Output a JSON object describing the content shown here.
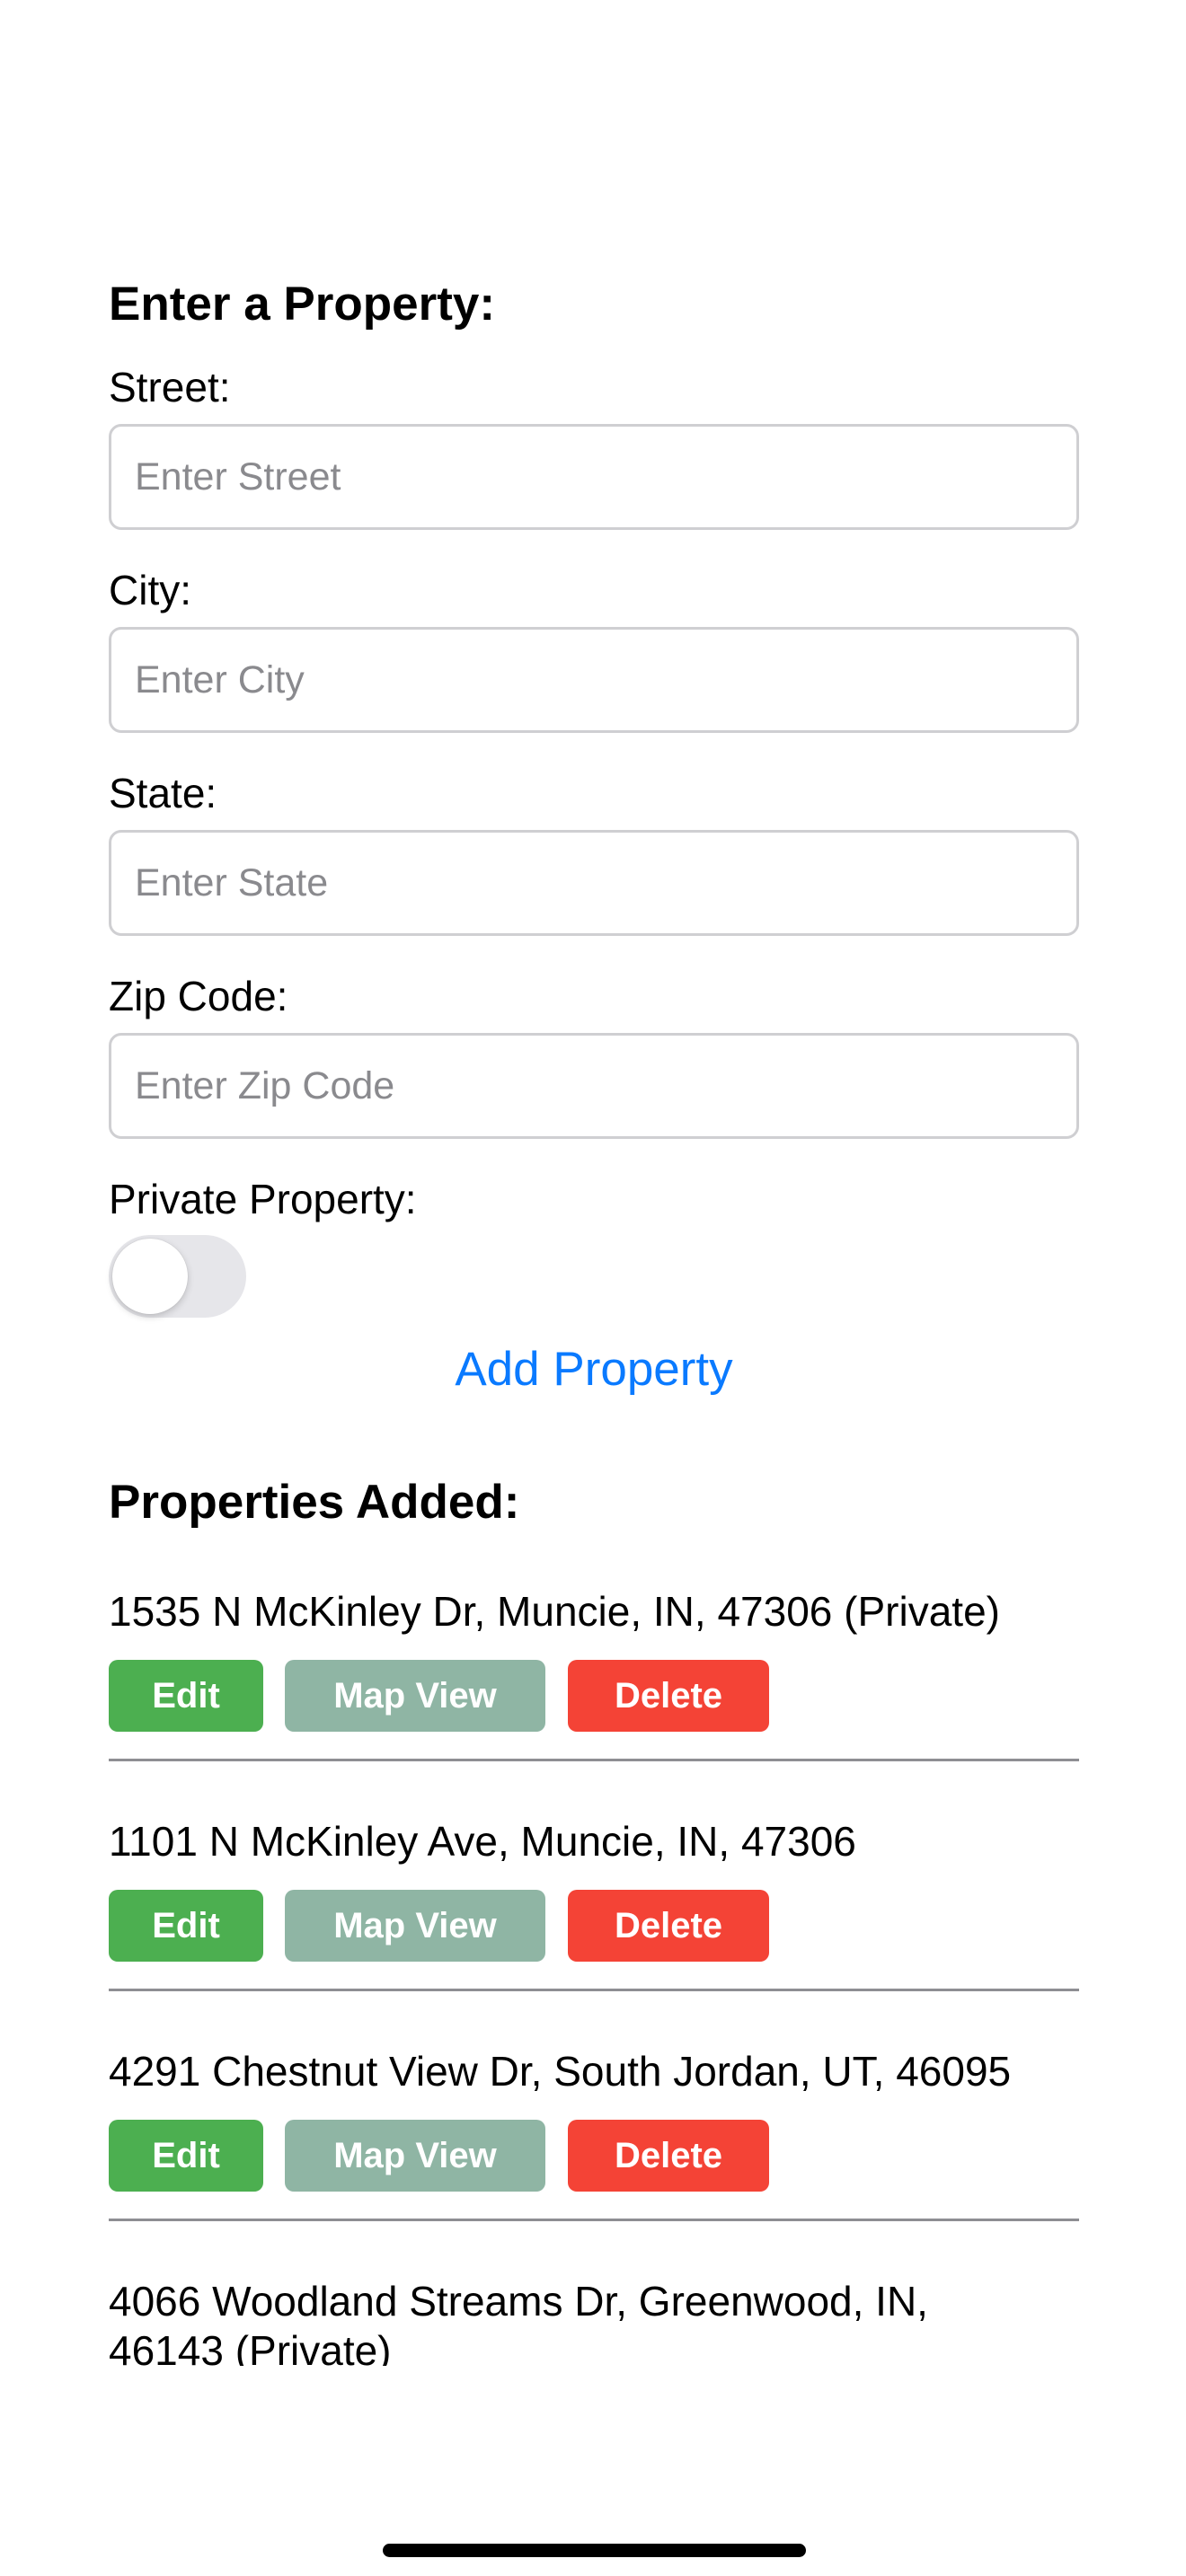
{
  "form": {
    "title": "Enter a Property:",
    "street_label": "Street:",
    "street_placeholder": "Enter Street",
    "street_value": "",
    "city_label": "City:",
    "city_placeholder": "Enter City",
    "city_value": "",
    "state_label": "State:",
    "state_placeholder": "Enter State",
    "state_value": "",
    "zip_label": "Zip Code:",
    "zip_placeholder": "Enter Zip Code",
    "zip_value": "",
    "private_label": "Private Property:",
    "private_on": false,
    "add_button": "Add Property"
  },
  "properties": {
    "title": "Properties Added:",
    "edit_label": "Edit",
    "map_label": "Map View",
    "delete_label": "Delete",
    "items": [
      {
        "address": "1535 N McKinley Dr, Muncie, IN, 47306 (Private)"
      },
      {
        "address": "1101 N McKinley Ave, Muncie, IN, 47306"
      },
      {
        "address": "4291 Chestnut View Dr, South Jordan, UT, 46095"
      },
      {
        "address_line1": "4066 Woodland Streams Dr, Greenwood, IN,",
        "address_line2": "46143 (Private)"
      }
    ]
  },
  "colors": {
    "edit": "#4caf50",
    "map_view": "#8fb5a4",
    "delete": "#f44336",
    "link_blue": "#0a7aff"
  }
}
